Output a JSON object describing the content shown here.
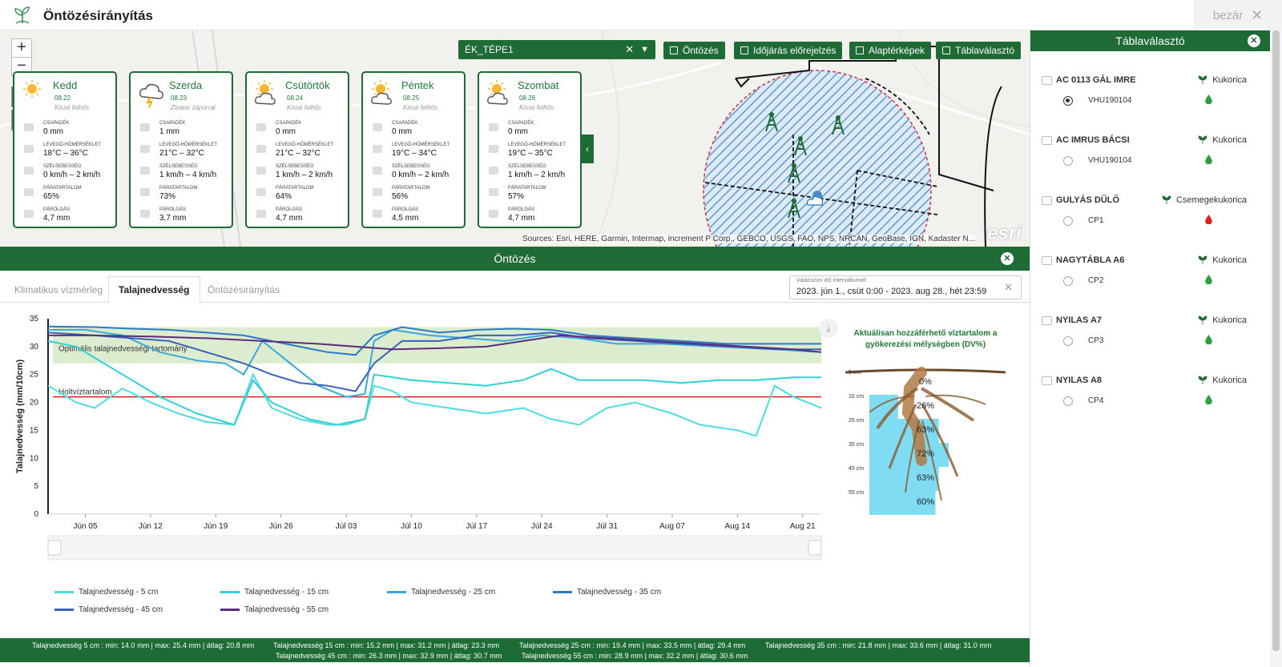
{
  "app": {
    "title": "Öntözésirányítás",
    "close_label": "bezár"
  },
  "map": {
    "field_select": "ÉK_TÉPE1",
    "tools": [
      "Öntözés",
      "Időjárás előrejelzés",
      "Alaptérképek",
      "Táblaválasztó"
    ],
    "attribution": "Sources: Esri, HERE, Garmin, Intermap, increment P Corp., GEBCO, USGS, FAO, NPS, NRCAN, GeoBase, IGN, Kadaster N...",
    "esri": "esri"
  },
  "weather_labels": {
    "precip": "CSAPADÉK",
    "temp": "LEVEGŐ-HŐMÉRSÉKLET",
    "wind": "SZÉLSEBESSÉG",
    "humidity": "PÁRATARTALOM",
    "evap": "PÁROLGÁS"
  },
  "weather": [
    {
      "day": "Kedd",
      "date": "08.22",
      "desc": "Kissé felhős",
      "icon": "sun-icon",
      "precip": "0 mm",
      "temp": "18°C – 36°C",
      "wind": "0 km/h – 2 km/h",
      "humidity": "65%",
      "evap": "4,7 mm"
    },
    {
      "day": "Szerda",
      "date": "08.23",
      "desc": "Zivatar záporral",
      "icon": "storm-icon",
      "precip": "1 mm",
      "temp": "21°C – 32°C",
      "wind": "1 km/h – 4 km/h",
      "humidity": "73%",
      "evap": "3,7 mm"
    },
    {
      "day": "Csütörtök",
      "date": "08.24",
      "desc": "Kissé felhős",
      "icon": "partly-cloudy-icon",
      "precip": "0 mm",
      "temp": "21°C – 32°C",
      "wind": "1 km/h – 2 km/h",
      "humidity": "64%",
      "evap": "4,7 mm"
    },
    {
      "day": "Péntek",
      "date": "08.25",
      "desc": "Kissé felhős",
      "icon": "partly-cloudy-icon",
      "precip": "0 mm",
      "temp": "19°C – 34°C",
      "wind": "0 km/h – 2 km/h",
      "humidity": "56%",
      "evap": "4,5 mm"
    },
    {
      "day": "Szombat",
      "date": "08.26",
      "desc": "Kissé felhős",
      "icon": "partly-cloudy-icon",
      "precip": "0 mm",
      "temp": "19°C – 35°C",
      "wind": "1 km/h – 2 km/h",
      "humidity": "57%",
      "evap": "4,7 mm"
    }
  ],
  "field_panel": {
    "title": "Táblaválasztó",
    "items": [
      {
        "name": "AC 0113 GÁL IMRE",
        "crop": "Kukorica",
        "code": "VHU190104",
        "selected": true,
        "drop_color": "#2e9e3e"
      },
      {
        "name": "AC IMRUS BÁCSI",
        "crop": "Kukorica",
        "code": "VHU190104",
        "selected": false,
        "drop_color": "#2e9e3e"
      },
      {
        "name": "GULYÁS DŰLŐ",
        "crop": "Csemegekukorica",
        "code": "CP1",
        "selected": false,
        "drop_color": "#e02020"
      },
      {
        "name": "NAGYTÁBLA A6",
        "crop": "Kukorica",
        "code": "CP2",
        "selected": false,
        "drop_color": "#2e9e3e"
      },
      {
        "name": "NYILAS A7",
        "crop": "Kukorica",
        "code": "CP3",
        "selected": false,
        "drop_color": "#2e9e3e"
      },
      {
        "name": "NYILAS A8",
        "crop": "Kukorica",
        "code": "CP4",
        "selected": false,
        "drop_color": "#2e9e3e"
      }
    ]
  },
  "irrigation": {
    "title": "Öntözés",
    "tabs": [
      "Klimatikus vízmérleg",
      "Talajnedvesség",
      "Öntözésirányítás"
    ],
    "active_tab": 1,
    "date_range_label": "Válasszon idő intervallumot!",
    "date_range_value": "2023. jún 1., csüt 0:00 - 2023. aug 28., hét 23:59"
  },
  "chart_data": {
    "type": "line",
    "ylabel": "Talajnedvesség (mm/10cm)",
    "ylim": [
      0,
      35
    ],
    "yticks": [
      0,
      5,
      10,
      15,
      20,
      25,
      30,
      35
    ],
    "xlim": [
      "2023-06-01",
      "2023-08-23"
    ],
    "xticks": [
      "Jún 05",
      "Jún 12",
      "Jún 19",
      "Jún 26",
      "Júl 03",
      "Júl 10",
      "Júl 17",
      "Júl 24",
      "Júl 31",
      "Aug 07",
      "Aug 14",
      "Aug 21"
    ],
    "xtick_dates": [
      "2023-06-05",
      "2023-06-12",
      "2023-06-19",
      "2023-06-26",
      "2023-07-03",
      "2023-07-10",
      "2023-07-17",
      "2023-07-24",
      "2023-07-31",
      "2023-08-07",
      "2023-08-14",
      "2023-08-21"
    ],
    "optimal_band": {
      "label": "Optimális talajnedvességi tartomány",
      "from": 27,
      "to": 33.5,
      "color": "#dbeccf"
    },
    "wilting_point": {
      "label": "Holtvíztartalom",
      "value": 21,
      "color": "#d62020"
    },
    "series": [
      {
        "name": "Talajnedvesség - 5 cm",
        "color": "#4ddde0",
        "points": [
          [
            "2023-06-01",
            23
          ],
          [
            "2023-06-04",
            20
          ],
          [
            "2023-06-06",
            19
          ],
          [
            "2023-06-09",
            22.5
          ],
          [
            "2023-06-12",
            20
          ],
          [
            "2023-06-15",
            18
          ],
          [
            "2023-06-18",
            16.5
          ],
          [
            "2023-06-21",
            16
          ],
          [
            "2023-06-23",
            25
          ],
          [
            "2023-06-25",
            19
          ],
          [
            "2023-06-28",
            17
          ],
          [
            "2023-07-01",
            16
          ],
          [
            "2023-07-03",
            16
          ],
          [
            "2023-07-05",
            17
          ],
          [
            "2023-07-06",
            23
          ],
          [
            "2023-07-08",
            22
          ],
          [
            "2023-07-10",
            20
          ],
          [
            "2023-07-14",
            19
          ],
          [
            "2023-07-18",
            18
          ],
          [
            "2023-07-22",
            19
          ],
          [
            "2023-07-25",
            17
          ],
          [
            "2023-07-28",
            16
          ],
          [
            "2023-07-31",
            19
          ],
          [
            "2023-08-03",
            20
          ],
          [
            "2023-08-07",
            18
          ],
          [
            "2023-08-10",
            16
          ],
          [
            "2023-08-14",
            15
          ],
          [
            "2023-08-16",
            14
          ],
          [
            "2023-08-18",
            23
          ],
          [
            "2023-08-20",
            21
          ],
          [
            "2023-08-23",
            19
          ]
        ]
      },
      {
        "name": "Talajnedvesség - 15 cm",
        "color": "#2fd1d6",
        "points": [
          [
            "2023-06-01",
            31
          ],
          [
            "2023-06-04",
            30
          ],
          [
            "2023-06-07",
            27
          ],
          [
            "2023-06-10",
            24
          ],
          [
            "2023-06-13",
            21
          ],
          [
            "2023-06-17",
            18
          ],
          [
            "2023-06-21",
            16
          ],
          [
            "2023-06-23",
            24
          ],
          [
            "2023-06-25",
            20
          ],
          [
            "2023-06-29",
            17
          ],
          [
            "2023-07-02",
            16
          ],
          [
            "2023-07-05",
            17
          ],
          [
            "2023-07-06",
            25
          ],
          [
            "2023-07-10",
            24
          ],
          [
            "2023-07-14",
            23.5
          ],
          [
            "2023-07-18",
            23
          ],
          [
            "2023-07-22",
            24
          ],
          [
            "2023-07-25",
            26
          ],
          [
            "2023-07-28",
            24
          ],
          [
            "2023-07-31",
            24
          ],
          [
            "2023-08-04",
            24
          ],
          [
            "2023-08-08",
            23.5
          ],
          [
            "2023-08-12",
            24
          ],
          [
            "2023-08-16",
            24
          ],
          [
            "2023-08-20",
            24.5
          ],
          [
            "2023-08-23",
            24.5
          ]
        ]
      },
      {
        "name": "Talajnedvesség - 25 cm",
        "color": "#3aa8d8",
        "points": [
          [
            "2023-06-01",
            33
          ],
          [
            "2023-06-05",
            33
          ],
          [
            "2023-06-09",
            32
          ],
          [
            "2023-06-13",
            29
          ],
          [
            "2023-06-17",
            27.5
          ],
          [
            "2023-06-20",
            27
          ],
          [
            "2023-06-22",
            25
          ],
          [
            "2023-06-24",
            31
          ],
          [
            "2023-06-27",
            27
          ],
          [
            "2023-06-30",
            23
          ],
          [
            "2023-07-03",
            21
          ],
          [
            "2023-07-05",
            21.5
          ],
          [
            "2023-07-06",
            31
          ],
          [
            "2023-07-08",
            33
          ],
          [
            "2023-07-12",
            32
          ],
          [
            "2023-07-16",
            31.5
          ],
          [
            "2023-07-20",
            31
          ],
          [
            "2023-07-24",
            32
          ],
          [
            "2023-07-28",
            31.5
          ],
          [
            "2023-08-01",
            30.5
          ],
          [
            "2023-08-06",
            30.5
          ],
          [
            "2023-08-12",
            30
          ],
          [
            "2023-08-18",
            29.5
          ],
          [
            "2023-08-23",
            29
          ]
        ]
      },
      {
        "name": "Talajnedvesség - 35 cm",
        "color": "#2d78c8",
        "points": [
          [
            "2023-06-01",
            33.6
          ],
          [
            "2023-06-06",
            33.5
          ],
          [
            "2023-06-10",
            33.2
          ],
          [
            "2023-06-14",
            33
          ],
          [
            "2023-06-18",
            32.5
          ],
          [
            "2023-06-22",
            32
          ],
          [
            "2023-06-25",
            31
          ],
          [
            "2023-06-28",
            30
          ],
          [
            "2023-07-01",
            29
          ],
          [
            "2023-07-04",
            28.5
          ],
          [
            "2023-07-06",
            32
          ],
          [
            "2023-07-09",
            33.5
          ],
          [
            "2023-07-13",
            32.5
          ],
          [
            "2023-07-17",
            33
          ],
          [
            "2023-07-21",
            33.2
          ],
          [
            "2023-07-25",
            33
          ],
          [
            "2023-07-29",
            32
          ],
          [
            "2023-08-03",
            31.5
          ],
          [
            "2023-08-08",
            31
          ],
          [
            "2023-08-13",
            30.5
          ],
          [
            "2023-08-18",
            30.5
          ],
          [
            "2023-08-23",
            30.5
          ]
        ]
      },
      {
        "name": "Talajnedvesség - 45 cm",
        "color": "#3a63b8",
        "points": [
          [
            "2023-06-01",
            32.5
          ],
          [
            "2023-06-06",
            32
          ],
          [
            "2023-06-10",
            31.5
          ],
          [
            "2023-06-14",
            31
          ],
          [
            "2023-06-18",
            29
          ],
          [
            "2023-06-22",
            27
          ],
          [
            "2023-06-25",
            25
          ],
          [
            "2023-06-28",
            23.5
          ],
          [
            "2023-07-01",
            23
          ],
          [
            "2023-07-04",
            22
          ],
          [
            "2023-07-06",
            27
          ],
          [
            "2023-07-09",
            31
          ],
          [
            "2023-07-13",
            31
          ],
          [
            "2023-07-17",
            32
          ],
          [
            "2023-07-21",
            32
          ],
          [
            "2023-07-25",
            32.5
          ],
          [
            "2023-07-29",
            31.5
          ],
          [
            "2023-08-03",
            31
          ],
          [
            "2023-08-08",
            30.5
          ],
          [
            "2023-08-13",
            30
          ],
          [
            "2023-08-18",
            29.5
          ],
          [
            "2023-08-23",
            29.5
          ]
        ]
      },
      {
        "name": "Talajnedvesség - 55 cm",
        "color": "#5b2d7a",
        "points": [
          [
            "2023-06-01",
            32
          ],
          [
            "2023-06-06",
            32
          ],
          [
            "2023-06-12",
            31.8
          ],
          [
            "2023-06-18",
            31.5
          ],
          [
            "2023-06-24",
            31
          ],
          [
            "2023-06-30",
            30.5
          ],
          [
            "2023-07-04",
            30
          ],
          [
            "2023-07-08",
            29.5
          ],
          [
            "2023-07-13",
            29.7
          ],
          [
            "2023-07-18",
            30
          ],
          [
            "2023-07-22",
            31
          ],
          [
            "2023-07-26",
            32
          ],
          [
            "2023-07-31",
            31.5
          ],
          [
            "2023-08-05",
            31
          ],
          [
            "2023-08-10",
            30.5
          ],
          [
            "2023-08-15",
            30
          ],
          [
            "2023-08-20",
            29.5
          ],
          [
            "2023-08-23",
            29
          ]
        ]
      }
    ]
  },
  "roots": {
    "title": "Aktuálisan hozzáférhető víztartalom a gyökerezési mélységben (DV%)",
    "layers": [
      {
        "depth": "5 cm",
        "pct": "0%",
        "fill": 0
      },
      {
        "depth": "15 cm",
        "pct": "26%",
        "fill": 0.26
      },
      {
        "depth": "25 cm",
        "pct": "63%",
        "fill": 0.63
      },
      {
        "depth": "35 cm",
        "pct": "72%",
        "fill": 0.72
      },
      {
        "depth": "45 cm",
        "pct": "63%",
        "fill": 0.63
      },
      {
        "depth": "55 cm",
        "pct": "60%",
        "fill": 0.6
      }
    ]
  },
  "stats": [
    "Talajnedvesség 5 cm : min: 14.0 mm | max: 25.4 mm | átlag: 20.8 mm",
    "Talajnedvesség 15 cm : min: 15.2 mm | max: 31.2 mm | átlag: 23.3 mm",
    "Talajnedvesség 25 cm : min: 19.4 mm | max: 33.5 mm | átlag: 29.4 mm",
    "Talajnedvesség 35 cm : min: 21.8 mm | max: 33.6 mm | átlag: 31.0 mm",
    "Talajnedvesség 45 cm : min: 26.3 mm | max: 32.9 mm | átlag: 30.7 mm",
    "Talajnedvesség 55 cm : min: 28.9 mm | max: 32.2 mm | átlag: 30.6 mm"
  ]
}
